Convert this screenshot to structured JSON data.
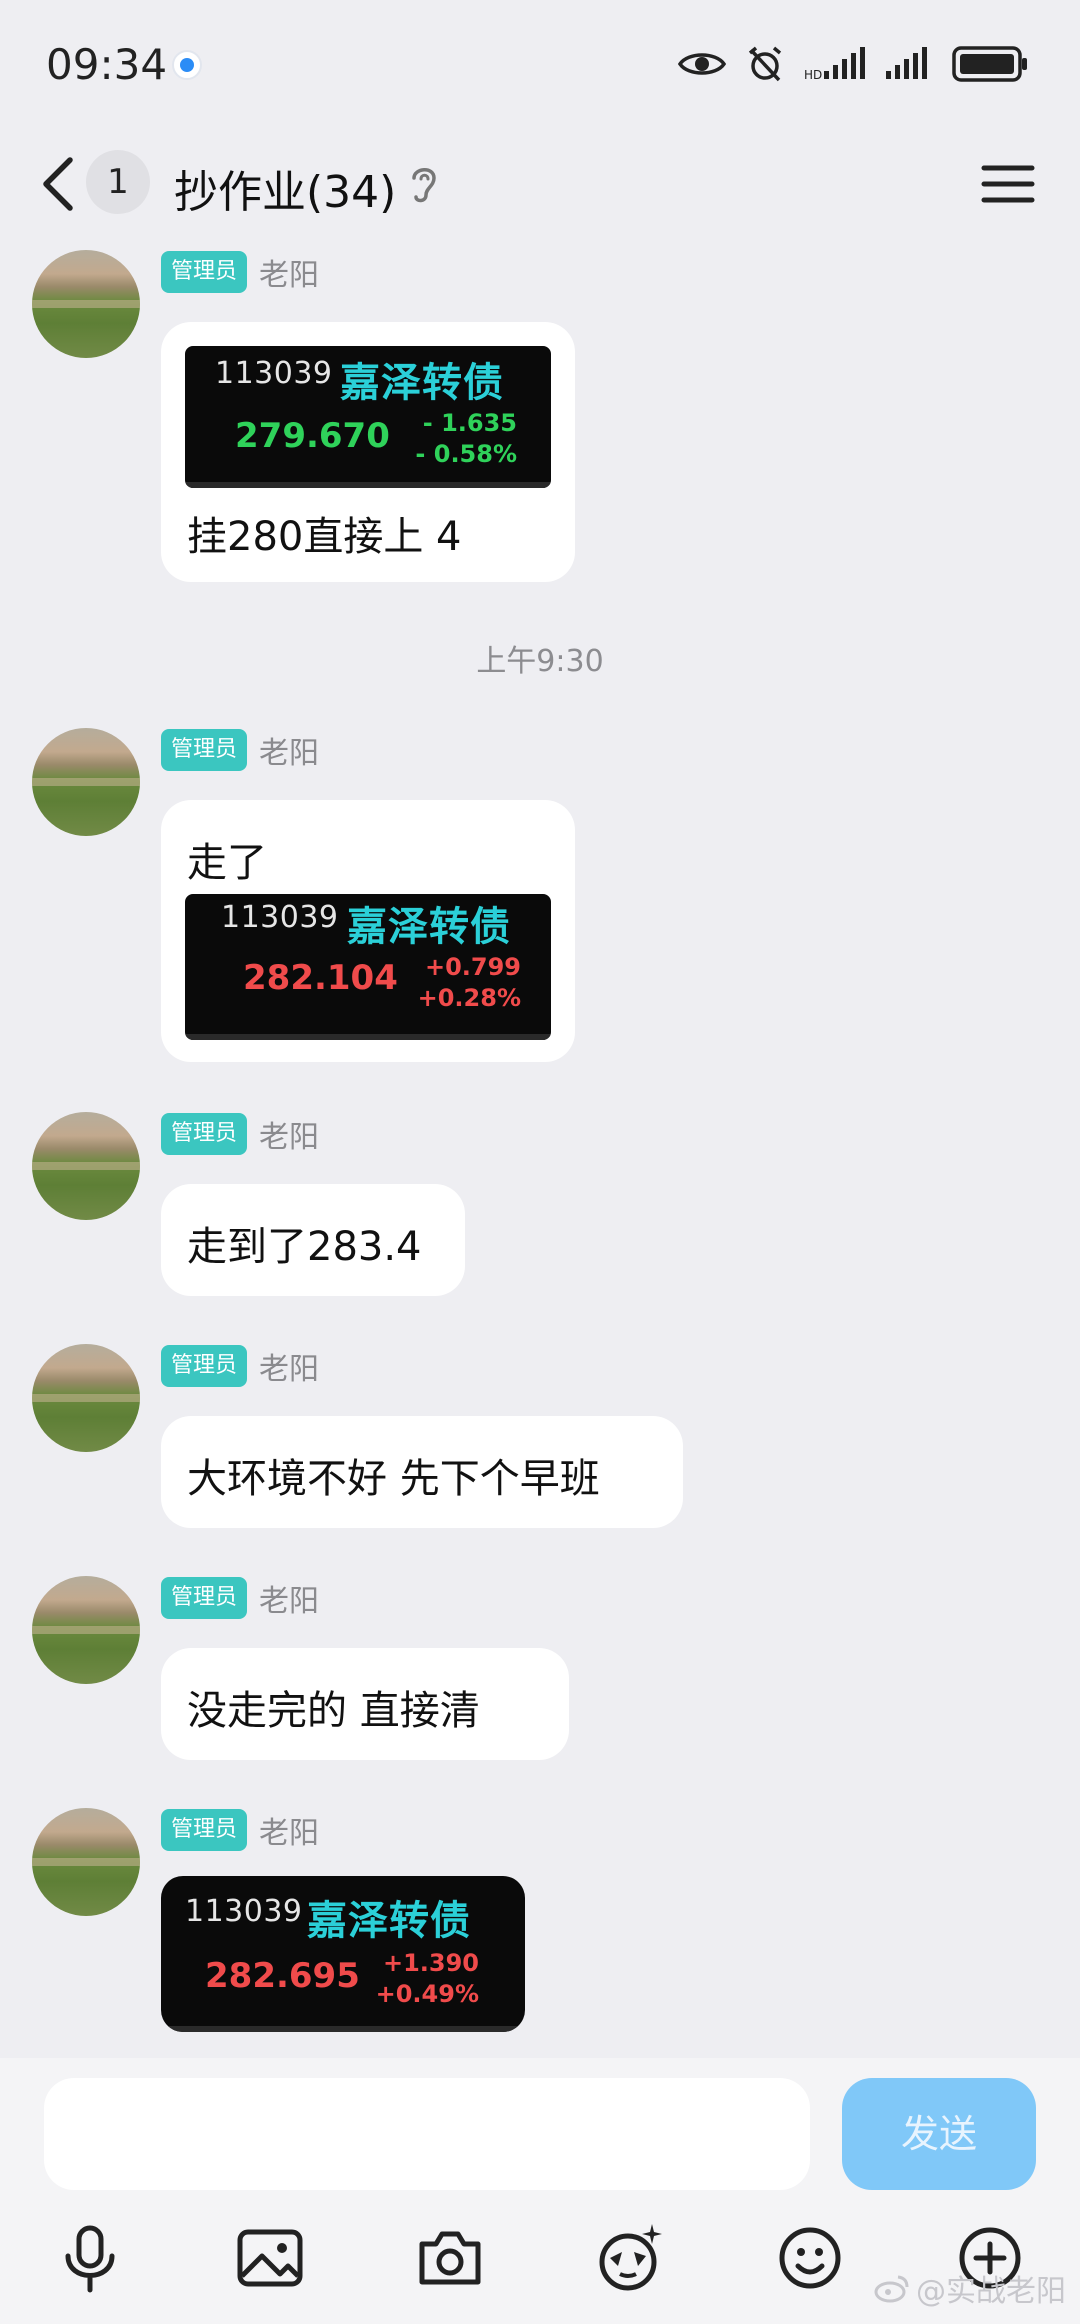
{
  "status_bar": {
    "time": "09:34"
  },
  "header": {
    "unread_count": "1",
    "title": "抄作业(34)"
  },
  "messages": [
    {
      "role": "管理员",
      "sender": "老阳",
      "quote": {
        "code": "113039",
        "name": "嘉泽转债",
        "price": "279.670",
        "change": "- 1.635",
        "change_pct": "- 0.58%"
      },
      "text": "挂280直接上  4"
    },
    {
      "role": "管理员",
      "sender": "老阳",
      "text": "走了",
      "quote": {
        "code": "113039",
        "name": "嘉泽转债",
        "price": "282.104",
        "change": "+0.799",
        "change_pct": "+0.28%"
      }
    },
    {
      "role": "管理员",
      "sender": "老阳",
      "text": "走到了283.4"
    },
    {
      "role": "管理员",
      "sender": "老阳",
      "text": "大环境不好 先下个早班"
    },
    {
      "role": "管理员",
      "sender": "老阳",
      "text": "没走完的 直接清"
    },
    {
      "role": "管理员",
      "sender": "老阳",
      "quote": {
        "code": "113039",
        "name": "嘉泽转债",
        "price": "282.695",
        "change": "+1.390",
        "change_pct": "+0.49%"
      }
    }
  ],
  "timestamp": "上午9:30",
  "composer": {
    "send_label": "发送"
  },
  "toolbar": {
    "icons": [
      "microphone-icon",
      "image-icon",
      "camera-icon",
      "sticker-icon",
      "emoji-icon",
      "plus-icon"
    ]
  },
  "watermark": "@实战老阳",
  "colors": {
    "role_badge": "#3bc6c0",
    "send_button": "#80c8f8",
    "price_up": "#f04b4b",
    "price_down": "#2fd25a",
    "quote_name": "#2bd0d8"
  }
}
